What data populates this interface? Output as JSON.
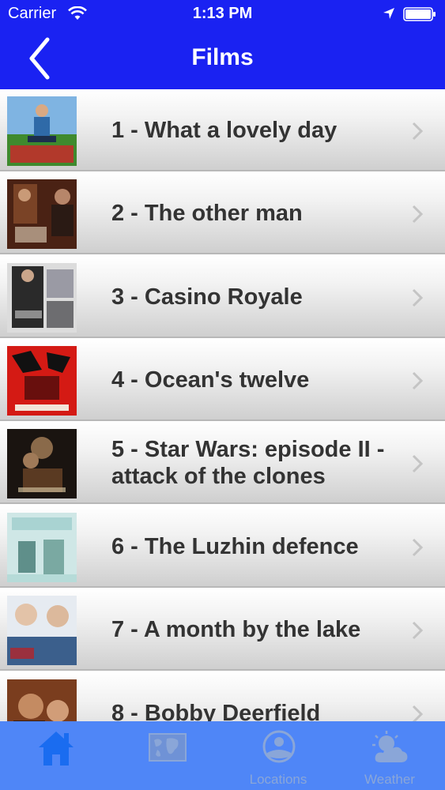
{
  "status_bar": {
    "carrier": "Carrier",
    "time": "1:13 PM"
  },
  "nav": {
    "title": "Films",
    "back_icon": "chevron-left-icon"
  },
  "films": [
    {
      "label": "1 - What a lovely day"
    },
    {
      "label": "2 - The other man"
    },
    {
      "label": "3 - Casino Royale"
    },
    {
      "label": "4 - Ocean's twelve"
    },
    {
      "label": "5 - Star Wars: episode II - attack of the clones"
    },
    {
      "label": "6 - The Luzhin defence"
    },
    {
      "label": "7 - A month by the lake"
    },
    {
      "label": "8 - Bobby Deerfield"
    }
  ],
  "tab_bar": {
    "tabs": [
      {
        "label": "",
        "icon": "home-icon",
        "selected": true
      },
      {
        "label": "",
        "icon": "world-map-icon",
        "selected": false
      },
      {
        "label": "Locations",
        "icon": "locations-icon",
        "selected": false
      },
      {
        "label": "Weather",
        "icon": "weather-icon",
        "selected": false
      }
    ]
  },
  "colors": {
    "nav_bar": "#1a22f2",
    "tab_bar": "#4f86f7",
    "tab_selected": "#1a6cf0",
    "title_text": "#333333"
  }
}
